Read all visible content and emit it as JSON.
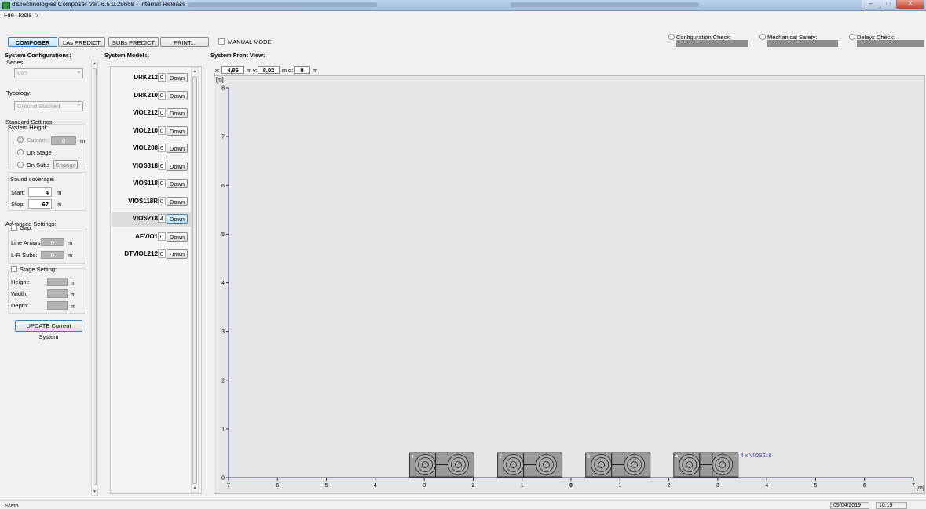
{
  "window": {
    "title": "d&Technologies Composer Ver. 6.5.0.29668 - Internal Release",
    "buttons": [
      "–",
      "□",
      "X"
    ]
  },
  "menu": [
    "File",
    "Tools",
    "?"
  ],
  "toolbar": {
    "tabs": [
      "COMPOSER",
      "LAs PREDICT",
      "SUBs PREDICT",
      "PRINT..."
    ],
    "manual_mode_label": "MANUAL MODE",
    "checks": [
      "Configuration Check:",
      "Mechanical Safety:",
      "Delays Check:"
    ]
  },
  "left": {
    "header": "System Configurations:",
    "series_label": "Series:",
    "series_value": "VIO",
    "typology_label": "Typology:",
    "typology_value": "Ground Stacked",
    "standard_settings": "Standard Settings:",
    "system_height": "System Height:",
    "custom_label": "Custom:",
    "custom_value": "0",
    "unit_m": "m",
    "on_stage": "On Stage",
    "on_subs": "On Subs",
    "change": "Change",
    "sound_coverage": "Sound coverage:",
    "start_label": "Start:",
    "start_value": "4",
    "stop_label": "Stop:",
    "stop_value": "67",
    "advanced": "Advanced Settings:",
    "gap": "Gap:",
    "line_arrays": "Line Arrays:",
    "lr_subs": "L-R Subs:",
    "gap_value": "0",
    "stage_setting": "Stage Setting:",
    "height": "Height:",
    "width": "Width:",
    "depth": "Depth:",
    "update": "UPDATE Current System"
  },
  "models": {
    "header": "System Models:",
    "down_label": "Down",
    "items": [
      {
        "name": "DRK212",
        "count": "0"
      },
      {
        "name": "DRK210",
        "count": "0"
      },
      {
        "name": "VIOL212",
        "count": "0"
      },
      {
        "name": "VIOL210",
        "count": "0"
      },
      {
        "name": "VIOL208",
        "count": "0"
      },
      {
        "name": "VIOS318",
        "count": "0"
      },
      {
        "name": "VIOS118",
        "count": "0"
      },
      {
        "name": "VIOS118R",
        "count": "0"
      },
      {
        "name": "VIOS218",
        "count": "4",
        "selected": true
      },
      {
        "name": "AFVIO1",
        "count": "0"
      },
      {
        "name": "DTVIOL212",
        "count": "0"
      }
    ]
  },
  "front_view": {
    "header": "System Front View:",
    "x_label": "x:",
    "x_value": "4,96",
    "y_label": "y:",
    "y_value": "8,02",
    "d_label": "d:",
    "d_value": "0",
    "unit": "m",
    "y_axis_unit": "[m]",
    "x_axis_unit": "[m]",
    "y_ticks": [
      "8",
      "7",
      "6",
      "5",
      "4",
      "3",
      "2",
      "1",
      "0"
    ],
    "x_ticks": [
      "7",
      "6",
      "5",
      "4",
      "3",
      "2",
      "1",
      "0",
      "1",
      "2",
      "3",
      "4",
      "5",
      "6",
      "7"
    ],
    "subs": [
      "1",
      "2",
      "3",
      "4"
    ],
    "array_label": "4 x VIOS218",
    "line_color": "#3b3bb0"
  },
  "status": {
    "left": "Stato",
    "date": "09/04/2019",
    "time": "10:19"
  }
}
